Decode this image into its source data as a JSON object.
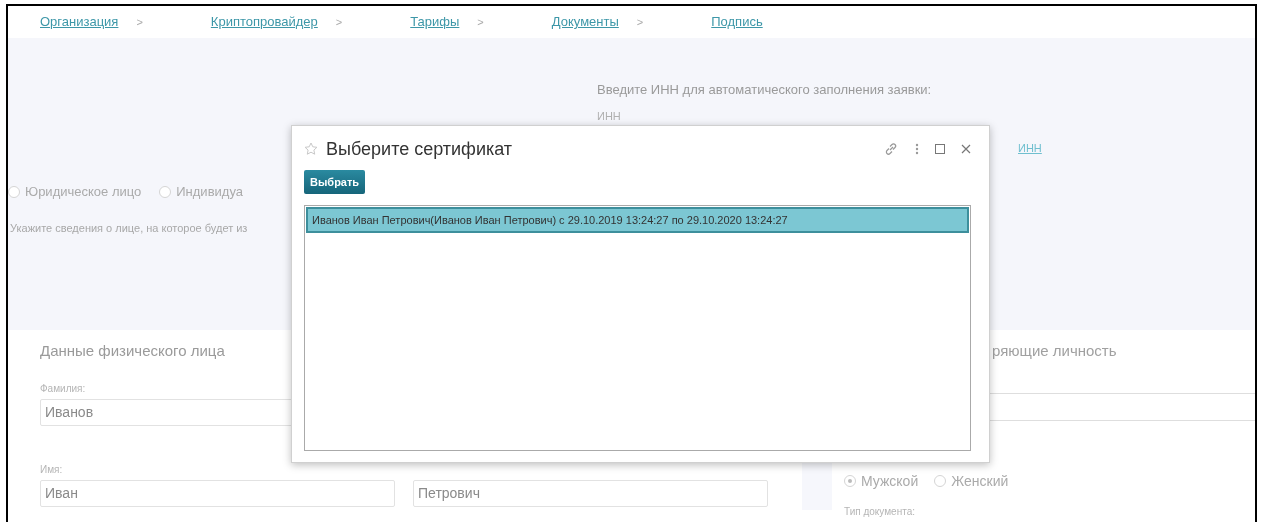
{
  "breadcrumbs": [
    {
      "label": "Организация",
      "separator": ">"
    },
    {
      "label": "Криптопровайдер",
      "separator": ">"
    },
    {
      "label": "Тарифы",
      "separator": ">"
    },
    {
      "label": "Документы",
      "separator": ">"
    },
    {
      "label": "Подпись"
    }
  ],
  "inn": {
    "prompt": "Введите ИНН для автоматического заполнения заявки:",
    "label": "ИНН",
    "link": "ИНН"
  },
  "entity_type": [
    {
      "label": "Юридическое лицо",
      "selected": false
    },
    {
      "label": "Индивидуа",
      "selected": false
    }
  ],
  "hint": "Укажите сведения о лице, на которое будет из",
  "person": {
    "title": "Данные физического лица",
    "surname": {
      "label": "Фамилия:",
      "value": "Иванов"
    },
    "name": {
      "label": "Имя:",
      "value": "Иван"
    },
    "patronymic": {
      "value": "Петрович"
    }
  },
  "documents": {
    "title": "ряющие личность",
    "gender": [
      {
        "label": "Мужской",
        "selected": true
      },
      {
        "label": "Женский",
        "selected": false
      }
    ],
    "doc_type_label": "Тип документа:"
  },
  "dialog": {
    "title": "Выберите сертификат",
    "button": "Выбрать",
    "certificates": [
      {
        "text": "Иванов Иван Петрович(Иванов Иван Петрович) с 29.10.2019 13:24:27 по 29.10.2020 13:24:27",
        "selected": true
      }
    ]
  }
}
